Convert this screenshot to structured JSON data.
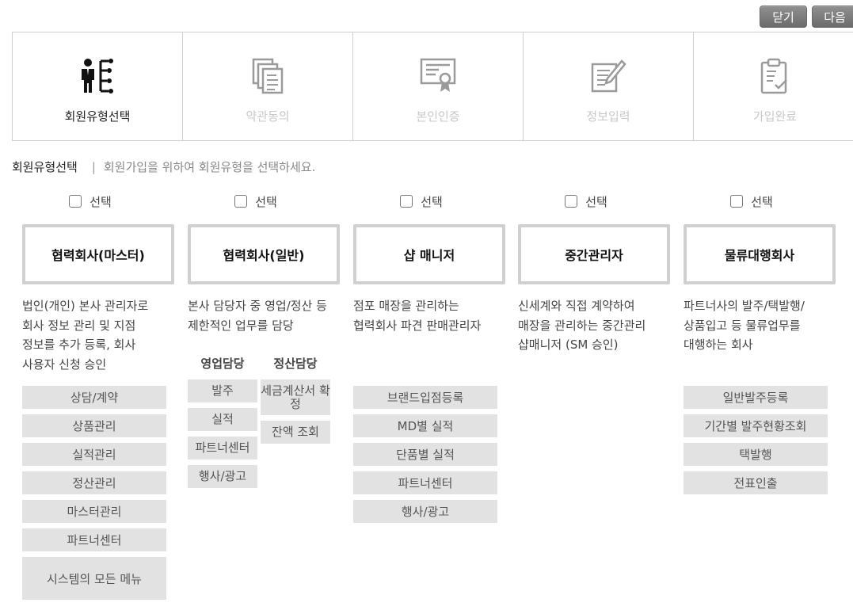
{
  "buttons": {
    "close": "닫기",
    "next": "다음"
  },
  "steps": [
    {
      "label": "회원유형선택",
      "icon": "person-org-icon",
      "active": true
    },
    {
      "label": "약관동의",
      "icon": "documents-icon",
      "active": false
    },
    {
      "label": "본인인증",
      "icon": "certificate-icon",
      "active": false
    },
    {
      "label": "정보입력",
      "icon": "edit-note-icon",
      "active": false
    },
    {
      "label": "가입완료",
      "icon": "clipboard-check-icon",
      "active": false
    }
  ],
  "section": {
    "title": "회원유형선택",
    "separator": "|",
    "description": "회원가입을 위하여 회원유형을 선택하세요."
  },
  "columns": [
    {
      "check_label": "선택",
      "name": "협력회사(마스터)",
      "description": "법인(개인) 본사 관리자로 회사 정보 관리 및 지점 정보를 추가 등록, 회사 사용자 신청 승인",
      "menus": [
        "상담/계약",
        "상품관리",
        "실적관리",
        "정산관리",
        "마스터관리",
        "파트너센터",
        "시스템의 모든 메뉴"
      ]
    },
    {
      "check_label": "선택",
      "name": "협력회사(일반)",
      "description": "본사 담당자 중 영업/정산 등 제한적인 업무를 담당",
      "sub": [
        {
          "head": "영업담당",
          "items": [
            "발주",
            "실적",
            "파트너센터",
            "행사/광고"
          ]
        },
        {
          "head": "정산담당",
          "items": [
            "세금계산서 확정",
            "잔액 조회"
          ]
        }
      ]
    },
    {
      "check_label": "선택",
      "name": "샵 매니저",
      "description": "점포 매장을 관리하는 협력회사 파견 판매관리자",
      "menus": [
        "브랜드입점등록",
        "MD별 실적",
        "단품별 실적",
        "파트너센터",
        "행사/광고"
      ]
    },
    {
      "check_label": "선택",
      "name": "중간관리자",
      "description": "신세계와 직접 계약하여 매장을 관리하는 중간관리 샵매니저 (SM 승인)",
      "menus": []
    },
    {
      "check_label": "선택",
      "name": "물류대행회사",
      "description": "파트너사의 발주/택발행/상품입고 등 물류업무를 대행하는 회사",
      "menus": [
        "일반발주등록",
        "기간별 발주현황조회",
        "택발행",
        "전표인출"
      ]
    }
  ]
}
